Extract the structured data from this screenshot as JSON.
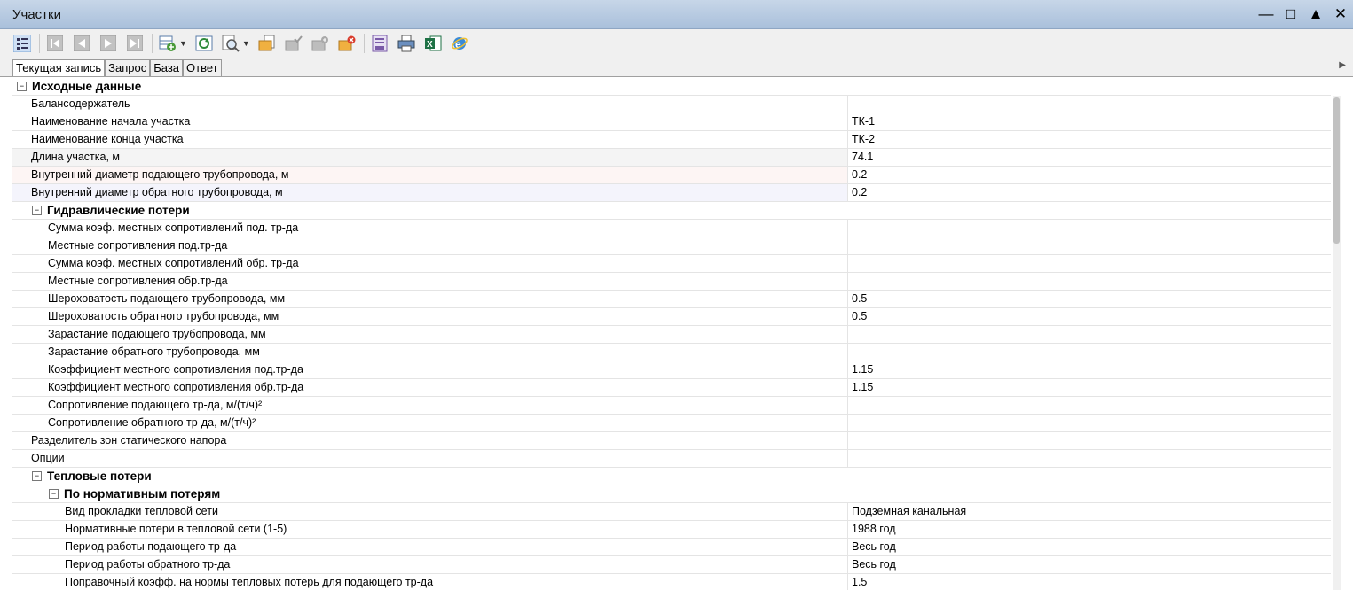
{
  "window": {
    "title": "Участки",
    "controls": [
      "minimize",
      "maximize",
      "restore",
      "close"
    ]
  },
  "tabs": [
    "Текущая запись",
    "Запрос",
    "База",
    "Ответ"
  ],
  "active_tab": "Текущая запись",
  "rows": [
    {
      "type": "cat",
      "level": 0,
      "name": "Исходные данные"
    },
    {
      "type": "prop",
      "level": 1,
      "name": "Балансодержатель",
      "value": ""
    },
    {
      "type": "prop",
      "level": 1,
      "name": "Наименование начала участка",
      "value": "ТК-1"
    },
    {
      "type": "prop",
      "level": 1,
      "name": "Наименование конца участка",
      "value": "ТК-2"
    },
    {
      "type": "prop",
      "level": 1,
      "name": "Длина участка, м",
      "value": "74.1",
      "hl": "grey"
    },
    {
      "type": "prop",
      "level": 1,
      "name": "Внутренний диаметр подающего трубопровода, м",
      "value": "0.2",
      "hl": "red"
    },
    {
      "type": "prop",
      "level": 1,
      "name": "Внутренний диаметр обратного трубопровода, м",
      "value": "0.2",
      "hl": "blue"
    },
    {
      "type": "cat",
      "level": 1,
      "name": "Гидравлические потери"
    },
    {
      "type": "prop",
      "level": 2,
      "name": "Сумма коэф. местных сопротивлений под. тр-да",
      "value": ""
    },
    {
      "type": "prop",
      "level": 2,
      "name": "Местные сопротивления под.тр-да",
      "value": ""
    },
    {
      "type": "prop",
      "level": 2,
      "name": "Сумма коэф. местных сопротивлений обр. тр-да",
      "value": ""
    },
    {
      "type": "prop",
      "level": 2,
      "name": "Местные сопротивления обр.тр-да",
      "value": ""
    },
    {
      "type": "prop",
      "level": 2,
      "name": "Шероховатость подающего трубопровода, мм",
      "value": "0.5"
    },
    {
      "type": "prop",
      "level": 2,
      "name": "Шероховатость обратного трубопровода, мм",
      "value": "0.5"
    },
    {
      "type": "prop",
      "level": 2,
      "name": "Зарастание подающего трубопровода, мм",
      "value": ""
    },
    {
      "type": "prop",
      "level": 2,
      "name": "Зарастание обратного трубопровода, мм",
      "value": ""
    },
    {
      "type": "prop",
      "level": 2,
      "name": "Коэффициент местного сопротивления под.тр-да",
      "value": "1.15"
    },
    {
      "type": "prop",
      "level": 2,
      "name": "Коэффициент местного сопротивления обр.тр-да",
      "value": "1.15"
    },
    {
      "type": "prop",
      "level": 2,
      "name": "Сопротивление подающего тр-да, м/(т/ч)²",
      "value": ""
    },
    {
      "type": "prop",
      "level": 2,
      "name": "Сопротивление обратного тр-да, м/(т/ч)²",
      "value": ""
    },
    {
      "type": "prop",
      "level": 1,
      "name": "Разделитель зон статического напора",
      "value": ""
    },
    {
      "type": "prop",
      "level": 1,
      "name": "Опции",
      "value": ""
    },
    {
      "type": "cat",
      "level": 1,
      "name": "Тепловые потери"
    },
    {
      "type": "cat",
      "level": 2,
      "name": "По нормативным потерям"
    },
    {
      "type": "prop",
      "level": 3,
      "name": "Вид прокладки тепловой сети",
      "value": "Подземная канальная"
    },
    {
      "type": "prop",
      "level": 3,
      "name": "Нормативные потери в тепловой сети (1-5)",
      "value": "1988 год"
    },
    {
      "type": "prop",
      "level": 3,
      "name": "Период работы подающего тр-да",
      "value": "Весь год"
    },
    {
      "type": "prop",
      "level": 3,
      "name": "Период работы обратного тр-да",
      "value": "Весь год"
    },
    {
      "type": "prop",
      "level": 3,
      "name": "Поправочный коэфф. на нормы тепловых потерь для подающего тр-да",
      "value": "1.5"
    }
  ],
  "colors": {
    "titlebar": "#b4c8e0",
    "grid_line": "#e4e4e4",
    "highlight_red": "#fdf5f4",
    "highlight_blue": "#f4f4fc"
  }
}
